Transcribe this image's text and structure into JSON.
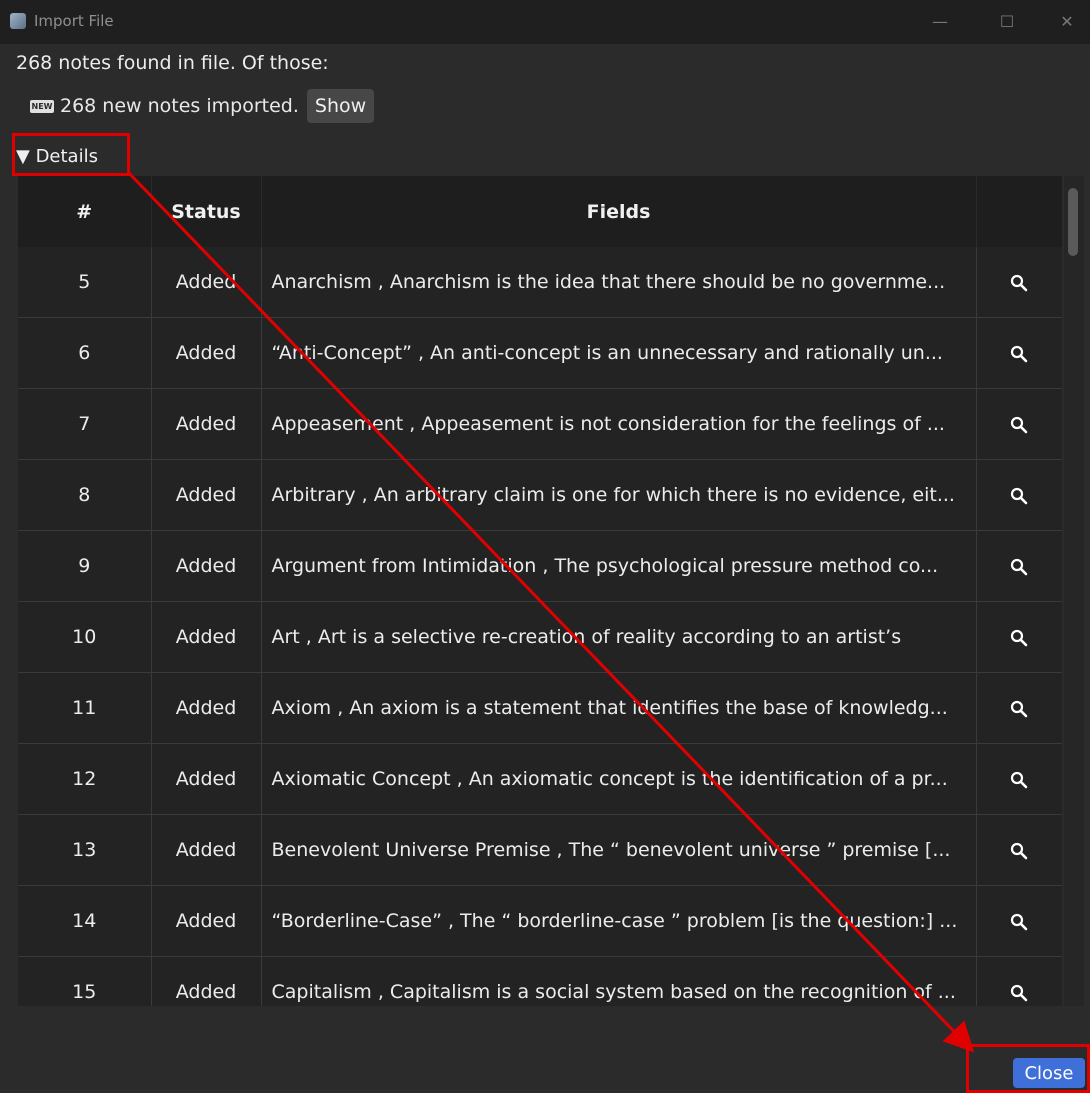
{
  "window": {
    "title": "Import File",
    "controls": {
      "minimize": "—",
      "maximize": "☐",
      "close": "✕"
    }
  },
  "summary": "268 notes found in file. Of those:",
  "imported": {
    "badge": "NEW",
    "text": "268 new notes imported.",
    "show_label": "Show"
  },
  "details_toggle": "▼ Details",
  "table": {
    "headers": [
      "#",
      "Status",
      "Fields",
      ""
    ],
    "rows": [
      {
        "num": "5",
        "status": "Added",
        "fields": "Anarchism , Anarchism is the idea that there should be no governme..."
      },
      {
        "num": "6",
        "status": "Added",
        "fields": "“Anti-Concept” , An anti-concept is an unnecessary and rationally un..."
      },
      {
        "num": "7",
        "status": "Added",
        "fields": "Appeasement , Appeasement is not consideration for the feelings of ..."
      },
      {
        "num": "8",
        "status": "Added",
        "fields": "Arbitrary , An arbitrary claim is one for which there is no evidence, eit..."
      },
      {
        "num": "9",
        "status": "Added",
        "fields": "Argument from Intimidation , The psychological pressure method co..."
      },
      {
        "num": "10",
        "status": "Added",
        "fields": "Art , Art is a selective re-creation of reality according to an artist’s"
      },
      {
        "num": "11",
        "status": "Added",
        "fields": "Axiom , An axiom is a statement that identifies the base of knowledg..."
      },
      {
        "num": "12",
        "status": "Added",
        "fields": "Axiomatic Concept , An axiomatic concept is the identification of a pr..."
      },
      {
        "num": "13",
        "status": "Added",
        "fields": "Benevolent Universe Premise , The “ benevolent universe ” premise [..."
      },
      {
        "num": "14",
        "status": "Added",
        "fields": "“Borderline-Case” , The “ borderline-case ” problem [is the question:] ..."
      },
      {
        "num": "15",
        "status": "Added",
        "fields": "Capitalism , Capitalism is a social system based on the recognition of ..."
      }
    ],
    "action_icon": "search-icon"
  },
  "close_label": "Close",
  "colors": {
    "accent": "#3f6fd8",
    "annotation": "#e00000",
    "background": "#2b2b2b"
  }
}
